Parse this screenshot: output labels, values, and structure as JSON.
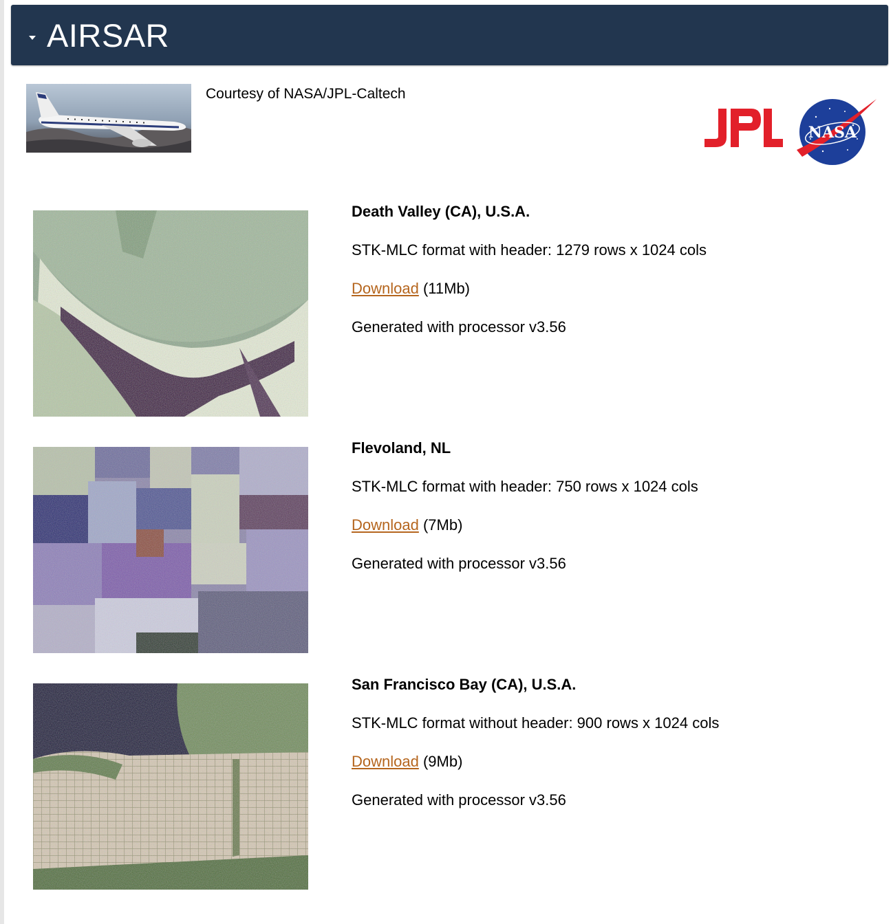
{
  "header": {
    "title": "AIRSAR",
    "caret_icon": "caret-down-icon",
    "color": "#22364f"
  },
  "credit": {
    "text": "Courtesy of NASA/JPL-Caltech",
    "plane_image": "aircraft-photo",
    "logos": [
      "jpl-logo",
      "nasa-meatball-logo"
    ]
  },
  "link_color": "#b5651d",
  "datasets": [
    {
      "name": "Death Valley (CA), U.S.A.",
      "format": "STK-MLC format with header: 1279 rows x 1024 cols",
      "download_label": "Download",
      "size": " (11Mb)",
      "processor": "Generated with processor v3.56",
      "thumbnail": "death-valley-sar-image"
    },
    {
      "name": "Flevoland, NL",
      "format": "STK-MLC format with header: 750 rows x 1024 cols",
      "download_label": "Download",
      "size": " (7Mb)",
      "processor": "Generated with processor v3.56",
      "thumbnail": "flevoland-sar-image"
    },
    {
      "name": "San Francisco Bay (CA), U.S.A.",
      "format": "STK-MLC format without header: 900 rows x 1024 cols",
      "download_label": "Download",
      "size": " (9Mb)",
      "processor": "Generated with processor v3.56",
      "thumbnail": "san-francisco-sar-image"
    }
  ]
}
